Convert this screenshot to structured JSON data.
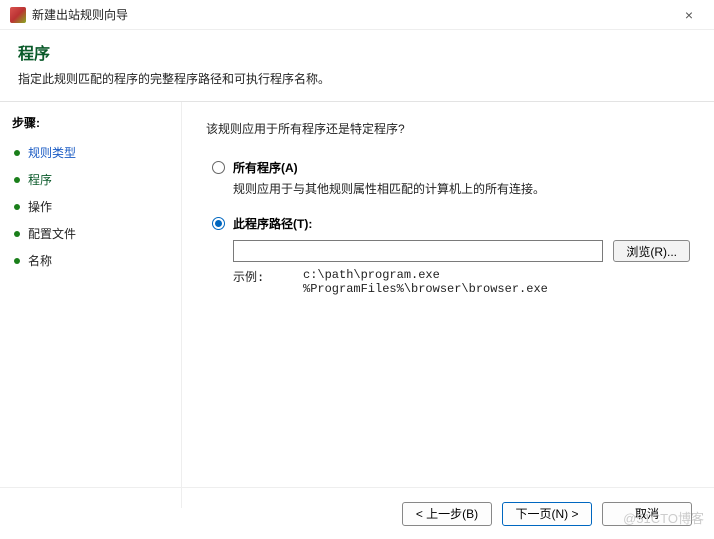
{
  "window": {
    "title": "新建出站规则向导",
    "close": "×"
  },
  "header": {
    "title": "程序",
    "desc": "指定此规则匹配的程序的完整程序路径和可执行程序名称。"
  },
  "sidebar": {
    "steps_title": "步骤:",
    "items": [
      {
        "label": "规则类型"
      },
      {
        "label": "程序"
      },
      {
        "label": "操作"
      },
      {
        "label": "配置文件"
      },
      {
        "label": "名称"
      }
    ]
  },
  "content": {
    "question": "该规则应用于所有程序还是特定程序?",
    "option_all": {
      "label": "所有程序(A)",
      "desc": "规则应用于与其他规则属性相匹配的计算机上的所有连接。"
    },
    "option_path": {
      "label": "此程序路径(T):",
      "value": "",
      "browse": "浏览(R)...",
      "example_label": "示例:",
      "example_paths": "c:\\path\\program.exe\n%ProgramFiles%\\browser\\browser.exe"
    }
  },
  "footer": {
    "back": "< 上一步(B)",
    "next": "下一页(N) >",
    "cancel": "取消"
  },
  "watermark": "@51CTO博客"
}
